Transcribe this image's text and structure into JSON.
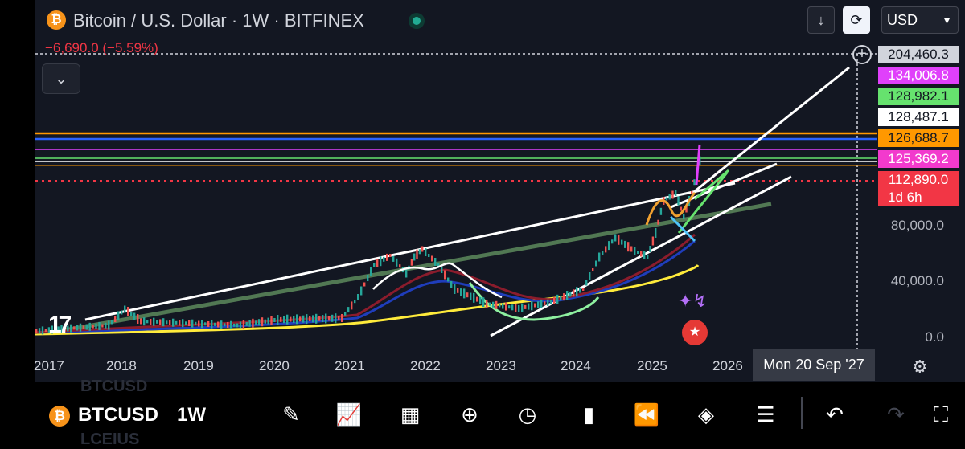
{
  "header": {
    "coin_symbol": "₿",
    "title": "Bitcoin / U.S. Dollar · 1W · BITFINEX",
    "change": "−6,690.0 (−5.59%)",
    "collapse_icon": "chevron-down-icon"
  },
  "top_controls": {
    "download_icon": "↓",
    "sync_icon": "⟳",
    "currency": "USD",
    "currency_chevron": "▾"
  },
  "price_labels": [
    {
      "value": "204,460.3",
      "bg": "#d1d4dc",
      "fg": "#131722"
    },
    {
      "value": "134,006.8",
      "bg": "#e040fb",
      "fg": "#ffffff"
    },
    {
      "value": "128,982.1",
      "bg": "#66e26e",
      "fg": "#131722"
    },
    {
      "value": "128,487.1",
      "bg": "#ffffff",
      "fg": "#131722"
    },
    {
      "value": "126,688.7",
      "bg": "#ff9800",
      "fg": "#131722"
    },
    {
      "value": "125,369.2",
      "bg": "#f23acd",
      "fg": "#ffffff"
    },
    {
      "value": "112,890.0",
      "bg": "#f23645",
      "fg": "#ffffff"
    }
  ],
  "countdown": "1d 6h",
  "axis": {
    "y_ticks": [
      "80,000.0",
      "40,000.0",
      "0.0"
    ],
    "x_ticks": [
      "2017",
      "2018",
      "2019",
      "2020",
      "2021",
      "2022",
      "2023",
      "2024",
      "2025",
      "2026"
    ],
    "crosshair_date": "Mon 20 Sep '27"
  },
  "logo": "17",
  "colors": {
    "background": "#131722",
    "up": "#26a69a",
    "down": "#ef5350",
    "orange_line": "#ff9800",
    "blue_line": "#2962ff",
    "magenta_line": "#e040fb",
    "green_line": "#66e26e",
    "yellow_ma": "#ffeb3b"
  },
  "bottom_bar": {
    "symbol": "BTCUSD",
    "timeframe": "1W",
    "ghost_top": "BTCUSD",
    "ghost_bottom": "LCEIUS",
    "tools": [
      "pencil-icon",
      "indicators-icon",
      "grid-icon",
      "add-icon",
      "alarm-icon",
      "candles-icon",
      "rewind-icon",
      "layers-icon",
      "settings-sliders-icon",
      "undo-icon",
      "redo-icon"
    ]
  }
}
